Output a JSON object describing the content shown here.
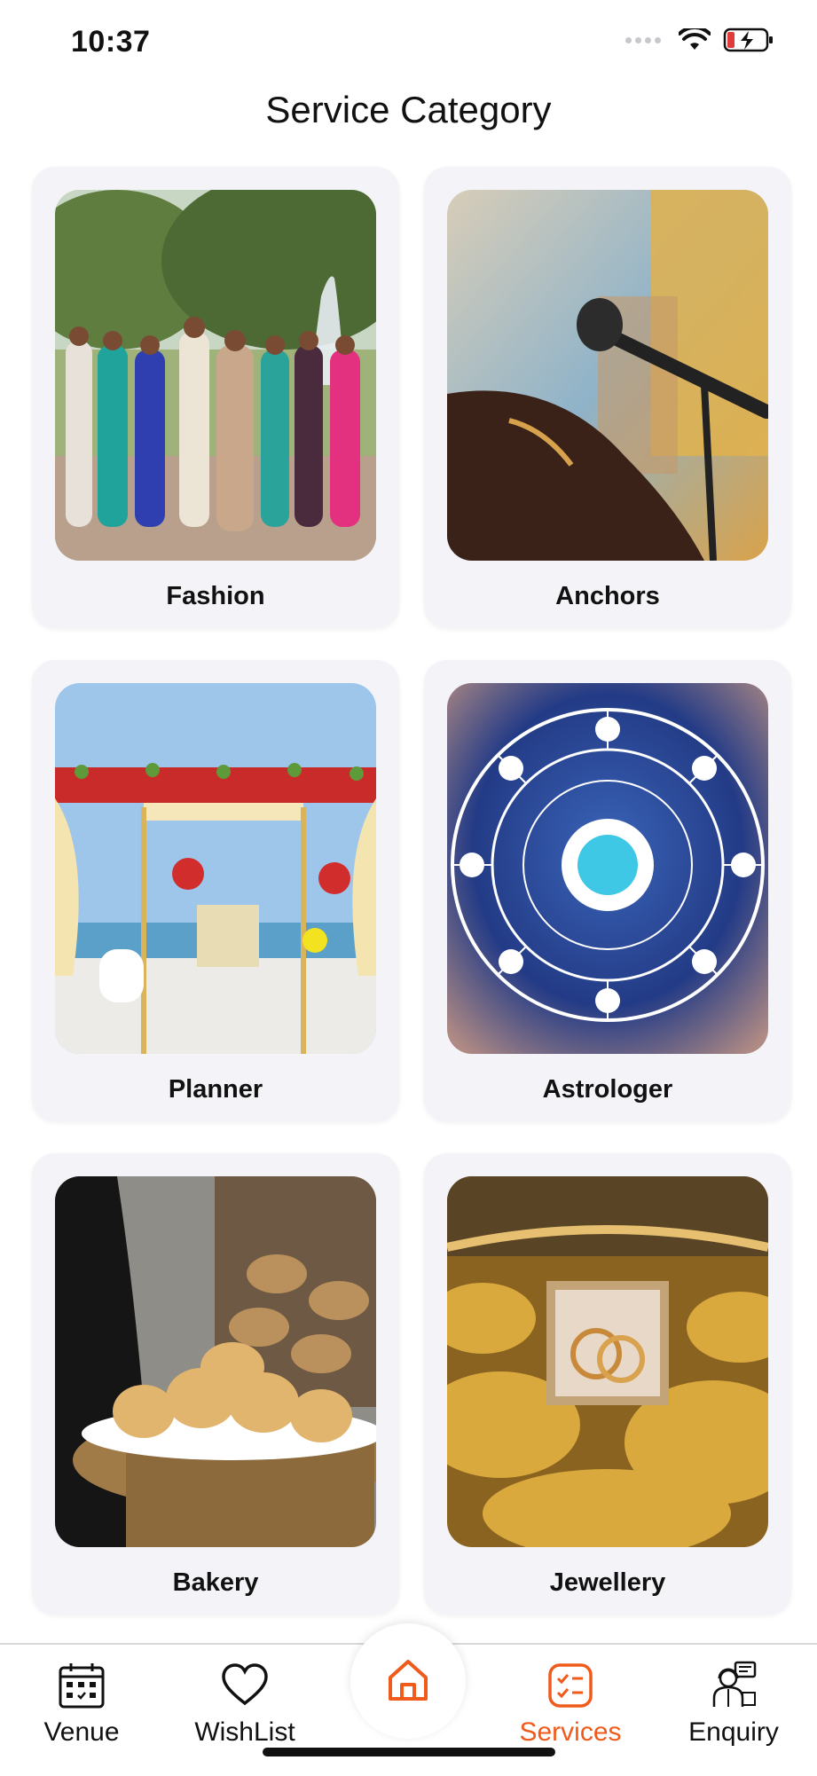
{
  "status_bar": {
    "time": "10:37"
  },
  "header": {
    "title": "Service Category"
  },
  "categories": [
    {
      "label": "Fashion"
    },
    {
      "label": "Anchors"
    },
    {
      "label": "Planner"
    },
    {
      "label": "Astrologer"
    },
    {
      "label": "Bakery"
    },
    {
      "label": "Jewellery"
    }
  ],
  "tab_bar": {
    "tabs": [
      {
        "label": "Venue",
        "icon": "calendar-icon"
      },
      {
        "label": "WishList",
        "icon": "heart-icon"
      },
      {
        "label": "",
        "icon": "home-icon"
      },
      {
        "label": "Services",
        "icon": "checklist-icon"
      },
      {
        "label": "Enquiry",
        "icon": "support-agent-icon"
      }
    ],
    "active": "Services"
  },
  "colors": {
    "accent": "#f05a1a",
    "card_bg": "#f3f3f8",
    "text": "#111111"
  }
}
